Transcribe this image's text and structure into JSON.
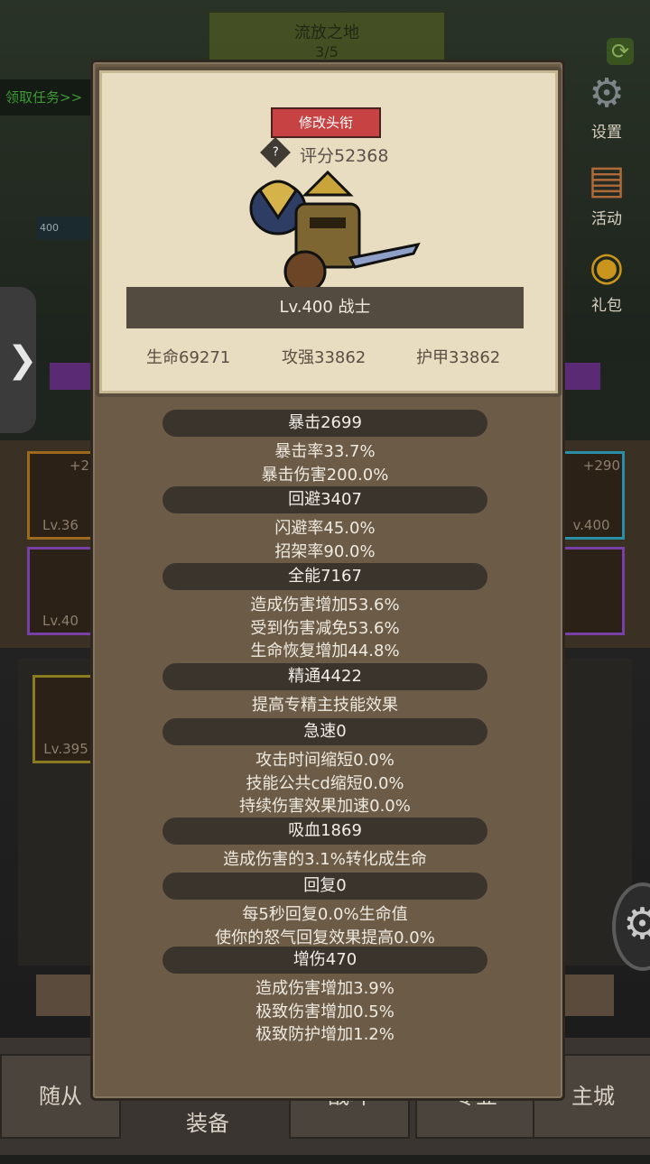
{
  "background": {
    "map_title": "流放之地",
    "map_progress": "3/5",
    "task_link": "领取任务>>",
    "level_badge": "400",
    "side_arrow": "❯",
    "slots": [
      {
        "plus": "+2",
        "level": "Lv.36"
      },
      {
        "plus": "",
        "level": "Lv.40"
      },
      {
        "plus": "+290",
        "level": "v.400"
      },
      {
        "plus": "",
        "level": ""
      }
    ],
    "equip_item_level": "Lv.395",
    "right_menu": [
      {
        "label": "设置",
        "icon": "gear-icon"
      },
      {
        "label": "活动",
        "icon": "activity-icon"
      },
      {
        "label": "礼包",
        "icon": "gift-icon"
      }
    ],
    "nav": [
      {
        "label": "随从"
      },
      {
        "label": "装备"
      },
      {
        "label": "战斗"
      },
      {
        "label": "专业"
      },
      {
        "label": "主城"
      }
    ]
  },
  "panel": {
    "rename_button": "修改头衔",
    "help": "?",
    "score": "评分52368",
    "level_class": "Lv.400 战士",
    "base_stats": {
      "hp": "生命69271",
      "attack": "攻强33862",
      "armor": "护甲33862"
    },
    "sections": [
      {
        "title": "暴击2699",
        "lines": [
          "暴击率33.7%",
          "暴击伤害200.0%"
        ]
      },
      {
        "title": "回避3407",
        "lines": [
          "闪避率45.0%",
          "招架率90.0%"
        ]
      },
      {
        "title": "全能7167",
        "lines": [
          "造成伤害增加53.6%",
          "受到伤害减免53.6%",
          "生命恢复增加44.8%"
        ]
      },
      {
        "title": "精通4422",
        "lines": [
          "提高专精主技能效果"
        ]
      },
      {
        "title": "急速0",
        "lines": [
          "攻击时间缩短0.0%",
          "技能公共cd缩短0.0%",
          "持续伤害效果加速0.0%"
        ]
      },
      {
        "title": "吸血1869",
        "lines": [
          "造成伤害的3.1%转化成生命"
        ]
      },
      {
        "title": "回复0",
        "lines": [
          "每5秒回复0.0%生命值",
          "使你的怒气回复效果提高0.0%"
        ]
      },
      {
        "title": "增伤470",
        "lines": [
          "造成伤害增加3.9%",
          "极致伤害增加0.5%",
          "极致防护增加1.2%"
        ]
      }
    ]
  }
}
